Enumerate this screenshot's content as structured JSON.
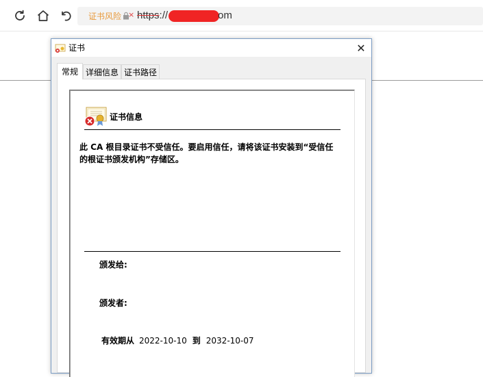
{
  "browser": {
    "risk_label": "证书风险",
    "x_mark": "×",
    "url_scheme": "https",
    "url_sep": "://",
    "url_suffix": "om"
  },
  "dialog": {
    "title": "证书",
    "close_glyph": "✕",
    "tabs": [
      {
        "label": "常规",
        "active": true
      },
      {
        "label": "详细信息",
        "active": false
      },
      {
        "label": "证书路径",
        "active": false
      }
    ],
    "info_heading": "证书信息",
    "warning": "此 CA 根目录证书不受信任。要启用信任，请将该证书安装到“受信任的根证书颁发机构”存储区。",
    "issued_to_label": "颁发给:",
    "issued_by_label": "颁发者:",
    "validity_label": "有效期从",
    "valid_from": "2022-10-10",
    "to_label": "到",
    "valid_to": "2032-10-07"
  },
  "colors": {
    "risk": "#e89a3c",
    "redaction": "#f02424",
    "dialog_border": "#7a9cc4"
  }
}
